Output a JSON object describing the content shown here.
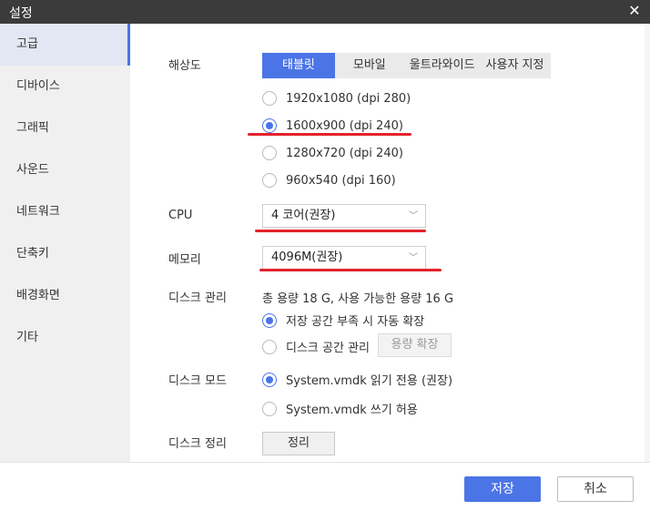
{
  "window": {
    "title": "설정",
    "close_icon": "close-icon"
  },
  "sidebar": {
    "items": [
      {
        "label": "고급",
        "active": true
      },
      {
        "label": "디바이스"
      },
      {
        "label": "그래픽"
      },
      {
        "label": "사운드"
      },
      {
        "label": "네트워크"
      },
      {
        "label": "단축키"
      },
      {
        "label": "배경화면"
      },
      {
        "label": "기타"
      }
    ]
  },
  "resolution": {
    "label": "해상도",
    "tabs": [
      "태블릿",
      "모바일",
      "울트라와이드",
      "사용자 지정"
    ],
    "active_tab": "태블릿",
    "options": [
      {
        "label": "1920x1080  (dpi 280)",
        "checked": false
      },
      {
        "label": "1600x900  (dpi 240)",
        "checked": true
      },
      {
        "label": "1280x720  (dpi 240)",
        "checked": false
      },
      {
        "label": "960x540  (dpi 160)",
        "checked": false
      }
    ]
  },
  "cpu": {
    "label": "CPU",
    "value": "4 코어(권장)"
  },
  "memory": {
    "label": "메모리",
    "value": "4096M(권장)"
  },
  "disk_management": {
    "label": "디스크 관리",
    "summary": "총 용량 18 G, 사용 가능한 용량 16 G",
    "options": [
      {
        "label": "저장 공간 부족 시 자동 확장",
        "checked": true
      },
      {
        "label": "디스크 공간 관리",
        "checked": false
      }
    ],
    "expand_button": "용량 확장"
  },
  "disk_mode": {
    "label": "디스크 모드",
    "options": [
      {
        "label": "System.vmdk 읽기 전용 (권장)",
        "checked": true
      },
      {
        "label": "System.vmdk 쓰기 허용",
        "checked": false
      }
    ]
  },
  "disk_cleanup": {
    "label": "디스크 정리",
    "button": "정리"
  },
  "footer": {
    "save": "저장",
    "cancel": "취소"
  },
  "colors": {
    "accent": "#4b74e6",
    "highlight_line": "#e3222c",
    "titlebar": "#3b3b3b"
  }
}
